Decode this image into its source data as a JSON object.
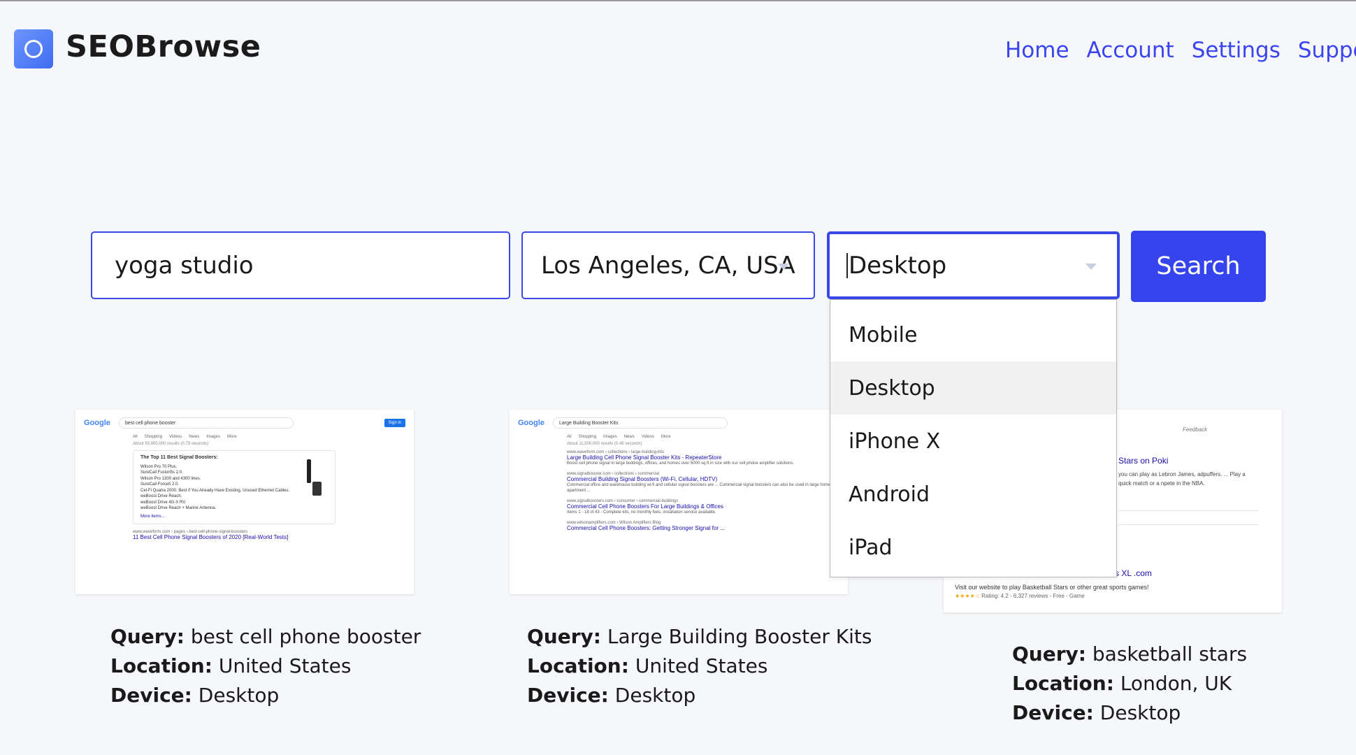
{
  "app": {
    "name": "SEOBrowse"
  },
  "nav": [
    "Home",
    "Account",
    "Settings",
    "Support"
  ],
  "search": {
    "query_value": "yoga studio",
    "location_value": "Los Angeles, CA, USA",
    "device_value": "Desktop",
    "button_label": "Search",
    "device_options": [
      "Mobile",
      "Desktop",
      "iPhone X",
      "Android",
      "iPad"
    ],
    "device_selected": "Desktop"
  },
  "labels": {
    "query": "Query:",
    "location": "Location:",
    "device": "Device:"
  },
  "cards": [
    {
      "query": "best cell phone booster",
      "location": "United States",
      "device": "Desktop",
      "preview": {
        "search_box": "best cell phone booster",
        "results_count": "About 93,800,000 results (0.79 seconds)",
        "snippet_title": "The Top 11 Best Signal Boosters:",
        "snippet_items": [
          "Wilson Pro 70 Plus.",
          "SureCall Fusion5s 2.0.",
          "Wilson Pro 1300 and 4300 lines.",
          "SureCall Force5 2.0.",
          "Cel-Fi Quatra 2000. Best if You Already Have Existing, Unused Ethernet Cables.",
          "weBoost Drive Reach.",
          "weBoost Drive 4G-X RV.",
          "weBoost Drive Reach + Marine Antenna."
        ],
        "snippet_more": "More items...",
        "result_url": "www.waveform.com › pages › best-cell-phone-signal-boosters",
        "result_title": "11 Best Cell Phone Signal Boosters of 2020 [Real-World Tests]"
      }
    },
    {
      "query": "Large Building Booster Kits",
      "location": "United States",
      "device": "Desktop",
      "preview": {
        "search_box": "Large Building Booster Kits",
        "results_count": "About 11,500,000 results (0.49 seconds)",
        "results": [
          {
            "url": "www.waveform.com › collections › large-building-kits",
            "title": "Large Building Cell Phone Signal Booster Kits - RepeaterStore",
            "desc": "Boost cell phone signal in large buildings, offices, and homes over 5000 sq ft in size with our cell phone amplifier solutions."
          },
          {
            "url": "www.signalbooster.com › collections › commercial",
            "title": "Commercial Building Signal Boosters (Wi-Fi, Cellular, HDTV)",
            "desc": "Commercial office and warehouse building wi-fi and cellular signal boosters are ... Commercial signal boosters can also be used in large homes, apartment ..."
          },
          {
            "url": "www.signalboosters.com › consumer › commercial-buildings",
            "title": "Commercial Cell Phone Boosters For Large Buildings & Offices",
            "desc": "Items 1 - 18 of 43 - Complete kits, no monthly fees, installation service available."
          },
          {
            "url": "www.wilsonamplifiers.com › Wilson Amplifiers Blog",
            "title": "Commercial Cell Phone Boosters: Getting Stronger Signal for ...",
            "desc": ""
          }
        ]
      }
    },
    {
      "query": "basketball stars",
      "location": "London, UK",
      "device": "Desktop",
      "preview": {
        "feedback": "Feedback",
        "title_fragment": "Stars on Poki",
        "desc_fragment": "you can play as Lebron James, adpuffers. ... Play a quick match or a npete in the NBA.",
        "result_title_fragment": "s XL .com",
        "result_desc": "Visit our website to play Basketball Stars or other great sports games!",
        "rating": "Rating: 4.2 - 6,327 reviews - Free - Game"
      }
    }
  ],
  "colors": {
    "accent": "#3644ee",
    "link": "#3b45ef",
    "border": "#3a48e6",
    "background": "#f6f7fa"
  }
}
